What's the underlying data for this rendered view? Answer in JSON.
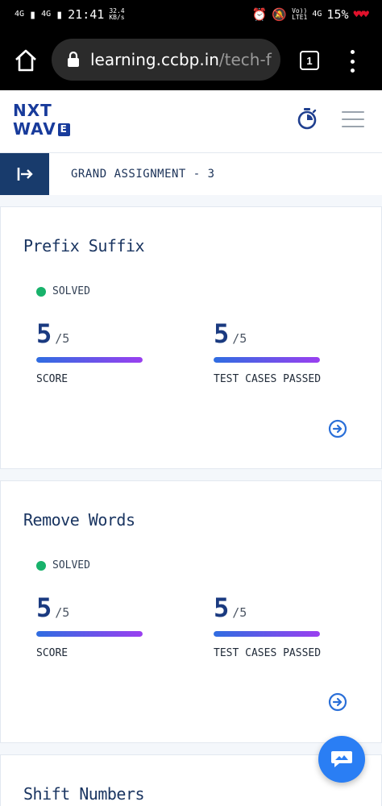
{
  "statusbar": {
    "sim1": "4G",
    "sim2": "4G",
    "time": "21:41",
    "speed_value": "32.4",
    "speed_unit": "KB/s",
    "volte": "Vo))",
    "lte": "LTE1",
    "net": "4G",
    "battery": "15%"
  },
  "browser": {
    "url_host": "learning.ccbp.in",
    "url_path": "/tech-f",
    "tab_count": "1"
  },
  "header": {
    "logo_line1": "NXT",
    "logo_line2": "WAV",
    "logo_box": "E"
  },
  "subheader": {
    "title": "GRAND ASSIGNMENT - 3"
  },
  "problems": [
    {
      "title": "Prefix Suffix",
      "status": "SOLVED",
      "score": "5",
      "score_total": "/5",
      "score_label": "SCORE",
      "score_progress": 1.0,
      "tests": "5",
      "tests_total": "/5",
      "tests_label": "TEST CASES PASSED",
      "tests_progress": 1.0
    },
    {
      "title": "Remove Words",
      "status": "SOLVED",
      "score": "5",
      "score_total": "/5",
      "score_label": "SCORE",
      "score_progress": 1.0,
      "tests": "5",
      "tests_total": "/5",
      "tests_label": "TEST CASES PASSED",
      "tests_progress": 1.0
    },
    {
      "title": "Shift Numbers"
    }
  ],
  "colors": {
    "brand": "#183b9b",
    "solved": "#18b26b",
    "accent": "#2a7ef4"
  },
  "icons": {
    "home": "home-icon",
    "lock": "lock-icon",
    "timer": "stopwatch-icon",
    "menu": "hamburger-icon",
    "sidebar": "sidebar-toggle-icon",
    "open": "arrow-circle-right-icon",
    "chat": "chat-icon"
  }
}
